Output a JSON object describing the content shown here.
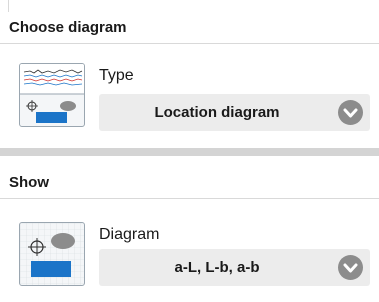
{
  "choose_section": {
    "title": "Choose diagram",
    "type_label": "Type",
    "type_value": "Location diagram",
    "icon": "type-diagram-icon"
  },
  "show_section": {
    "title": "Show",
    "diagram_label": "Diagram",
    "diagram_value": "a-L, L-b, a-b",
    "icon": "location-diagram-icon"
  },
  "colors": {
    "select_background": "#ececec",
    "chevron_circle": "#8c8c8c",
    "diagram_blue": "#1b74c8",
    "diagram_gray": "#8c8c8c",
    "trace_red": "#d0312d",
    "trace_blue": "#1b74c8"
  }
}
